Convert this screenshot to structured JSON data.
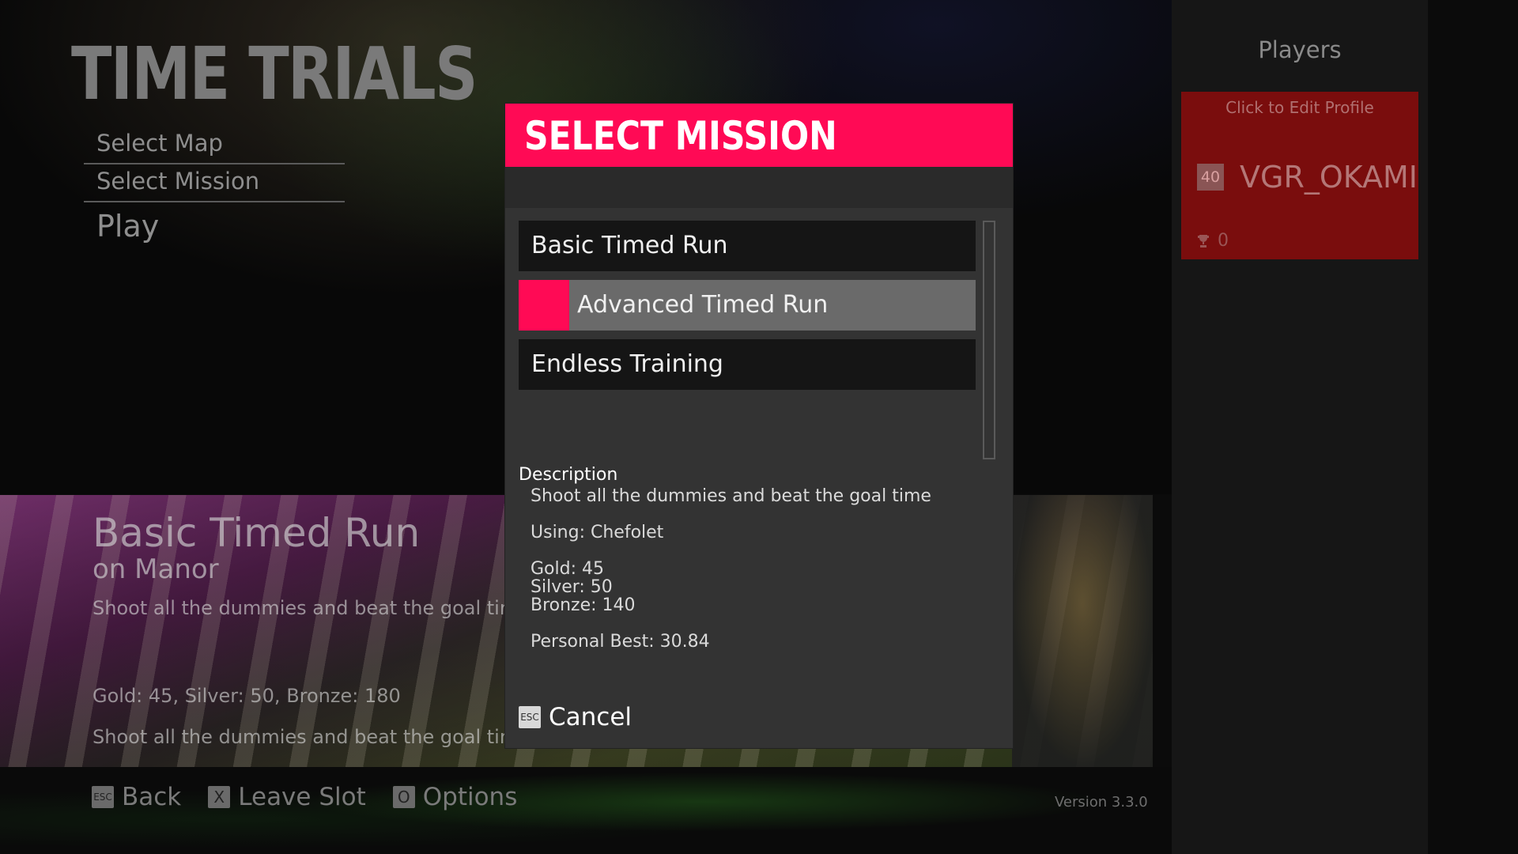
{
  "page": {
    "title": "TIME TRIALS"
  },
  "menu": {
    "items": [
      "Select Map",
      "Select Mission"
    ],
    "play": "Play"
  },
  "preview": {
    "mission_name": "Basic Timed Run",
    "map": "on Manor",
    "description": "Shoot all the dummies and beat the goal time",
    "medals": "Gold: 45, Silver: 50, Bronze: 180",
    "description2": "Shoot all the dummies and beat the goal time"
  },
  "footer": {
    "back": {
      "key": "ESC",
      "label": "Back"
    },
    "leave": {
      "key": "X",
      "label": "Leave Slot"
    },
    "options": {
      "key": "O",
      "label": "Options"
    },
    "version": "Version 3.3.0"
  },
  "sidebar": {
    "players_label": "Players",
    "profile": {
      "edit_label": "Click to Edit Profile",
      "level": "40",
      "name": "VGR_OKAMI",
      "trophies": "0"
    }
  },
  "dialog": {
    "title": "SELECT MISSION",
    "missions": [
      "Basic Timed Run",
      "Advanced Timed Run",
      "Endless Training"
    ],
    "selected_index": 1,
    "description_label": "Description",
    "description": "Shoot all the dummies and beat the goal time",
    "using": "Using: Chefolet",
    "gold": "Gold: 45",
    "silver": "Silver: 50",
    "bronze": "Bronze: 140",
    "personal_best": "Personal Best: 30.84",
    "cancel": {
      "key": "ESC",
      "label": "Cancel"
    }
  },
  "colors": {
    "accent": "#ff0a55",
    "profile_bg": "#7a0d0d",
    "dialog_bg": "#333333"
  }
}
